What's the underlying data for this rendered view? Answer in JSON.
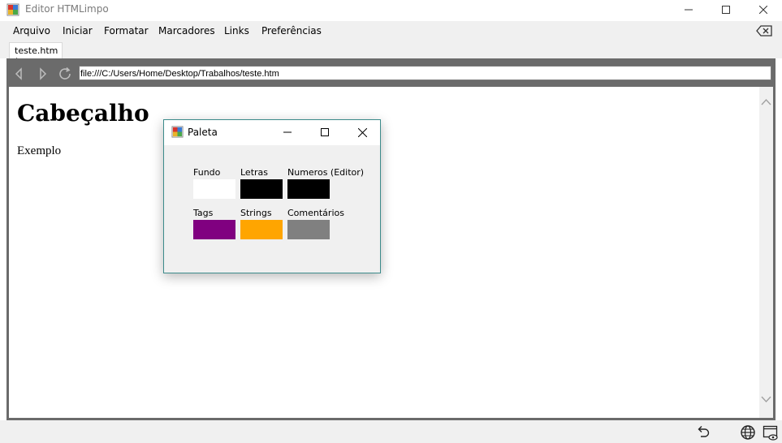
{
  "window": {
    "title": "Editor HTMLimpo"
  },
  "menu": {
    "items": [
      "Arquivo",
      "Iniciar",
      "Formatar",
      "Marcadores",
      "Links",
      "Preferências"
    ]
  },
  "tabs": [
    {
      "label": "teste.htm *"
    }
  ],
  "browser": {
    "address": "file:///C:/Users/Home/Desktop/Trabalhos/teste.htm"
  },
  "page": {
    "heading": "Cabeçalho",
    "paragraph": "Exemplo"
  },
  "palette": {
    "title": "Paleta",
    "swatches": [
      {
        "label": "Fundo",
        "color": "#ffffff"
      },
      {
        "label": "Letras",
        "color": "#000000"
      },
      {
        "label": "Numeros (Editor)",
        "color": "#000000"
      },
      {
        "label": "Tags",
        "color": "#800080"
      },
      {
        "label": "Strings",
        "color": "#ffa500"
      },
      {
        "label": "Comentários",
        "color": "#808080"
      }
    ]
  },
  "icons": {
    "app": "app-icon",
    "minimize": "minimize-icon",
    "maximize": "maximize-icon",
    "close": "close-icon",
    "clear": "backspace-icon",
    "back": "arrow-left-icon",
    "forward": "arrow-right-icon",
    "reload": "refresh-icon",
    "undo": "undo-icon",
    "globe": "globe-icon",
    "preview": "preview-window-icon"
  }
}
